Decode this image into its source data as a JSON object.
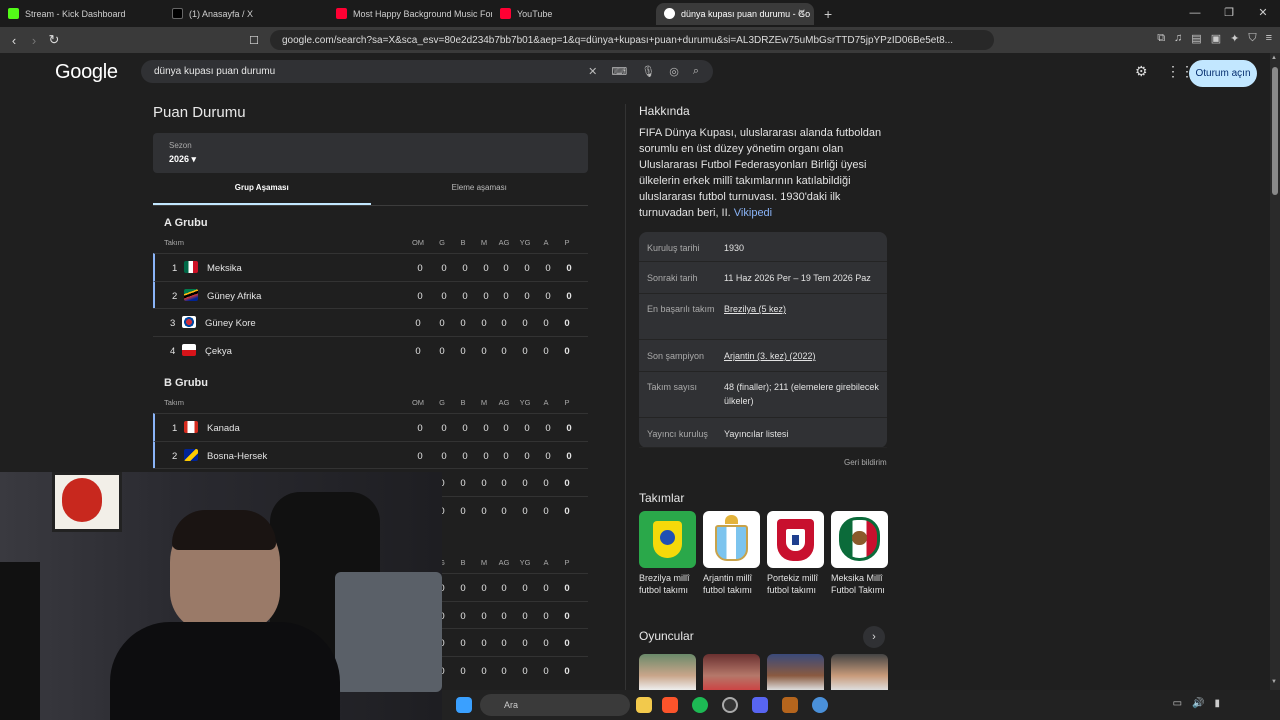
{
  "browser": {
    "tabs": [
      {
        "label": "Stream - Kick Dashboard",
        "color": "#53fc18"
      },
      {
        "label": "(1) Anasayfa / X",
        "color": "#000000"
      },
      {
        "label": "Most Happy Background Music For V",
        "color": "#ff0033"
      },
      {
        "label": "YouTube",
        "color": "#ff0033"
      },
      {
        "label": "dünya kupası puan durumu - Go",
        "color": "#ffffff"
      }
    ],
    "url": "google.com/search?sa=X&sca_esv=80e2d234b7bb7b01&aep=1&q=dünya+kupası+puan+durumu&si=AL3DRZEw75uMbGsrTTD75jpYPzID06Be5et8..."
  },
  "google": {
    "logo": "Google",
    "query": "dünya kupası puan durumu",
    "signin": "Oturum açın"
  },
  "standings": {
    "title": "Puan Durumu",
    "season_label": "Sezon",
    "season_value": "2026",
    "tab_group": "Grup Aşaması",
    "tab_knockout": "Eleme aşaması",
    "columns": {
      "team": "Takım",
      "om": "OM",
      "g": "G",
      "b": "B",
      "m": "M",
      "ag": "AG",
      "yg": "YG",
      "a": "A",
      "p": "P"
    },
    "groupA": {
      "name": "A Grubu",
      "rows": [
        {
          "pos": "1",
          "team": "Meksika",
          "v": [
            "0",
            "0",
            "0",
            "0",
            "0",
            "0",
            "0",
            "0"
          ]
        },
        {
          "pos": "2",
          "team": "Güney Afrika",
          "v": [
            "0",
            "0",
            "0",
            "0",
            "0",
            "0",
            "0",
            "0"
          ]
        },
        {
          "pos": "3",
          "team": "Güney Kore",
          "v": [
            "0",
            "0",
            "0",
            "0",
            "0",
            "0",
            "0",
            "0"
          ]
        },
        {
          "pos": "4",
          "team": "Çekya",
          "v": [
            "0",
            "0",
            "0",
            "0",
            "0",
            "0",
            "0",
            "0"
          ]
        }
      ]
    },
    "groupB": {
      "name": "B Grubu",
      "rows": [
        {
          "pos": "1",
          "team": "Kanada",
          "v": [
            "0",
            "0",
            "0",
            "0",
            "0",
            "0",
            "0",
            "0"
          ]
        },
        {
          "pos": "2",
          "team": "Bosna-Hersek",
          "v": [
            "0",
            "0",
            "0",
            "0",
            "0",
            "0",
            "0",
            "0"
          ]
        },
        {
          "pos": "",
          "team": "",
          "v": [
            "0",
            "0",
            "0",
            "0",
            "0",
            "0",
            "0",
            "0"
          ]
        },
        {
          "pos": "",
          "team": "",
          "v": [
            "0",
            "0",
            "0",
            "0",
            "0",
            "0",
            "0",
            "0"
          ]
        }
      ]
    },
    "groupC": {
      "rows": [
        {
          "pos": "",
          "team": "",
          "v": [
            "0",
            "0",
            "0",
            "0",
            "0",
            "0",
            "0",
            "0"
          ]
        },
        {
          "pos": "",
          "team": "",
          "v": [
            "0",
            "0",
            "0",
            "0",
            "0",
            "0",
            "0",
            "0"
          ]
        },
        {
          "pos": "",
          "team": "",
          "v": [
            "0",
            "0",
            "0",
            "0",
            "0",
            "0",
            "0",
            "0"
          ]
        },
        {
          "pos": "",
          "team": "",
          "v": [
            "0",
            "0",
            "0",
            "0",
            "0",
            "0",
            "0",
            "0"
          ]
        }
      ]
    }
  },
  "about": {
    "title": "Hakkında",
    "text": "FIFA Dünya Kupası, uluslararası alanda futboldan sorumlu en üst düzey yönetim organı olan Uluslararası Futbol Federasyonları Birliği üyesi ülkelerin erkek millî takımlarının katılabildiği uluslararası futbol turnuvası. 1930'daki ilk turnuvadan beri, II.",
    "link": "Vikipedi",
    "facts": [
      {
        "k": "Kuruluş tarihi",
        "v": "1930",
        "u": false
      },
      {
        "k": "Sonraki tarih",
        "v": "11 Haz 2026 Per – 19 Tem 2026 Paz",
        "u": false
      },
      {
        "k": "En başarılı takım",
        "v": "Brezilya (5 kez)",
        "u": true
      },
      {
        "k": "Son şampiyon",
        "v": "Arjantin (3. kez) (2022)",
        "u": true
      },
      {
        "k": "Takım sayısı",
        "v": "48 (finaller); 211 (elemelere girebilecek ülkeler)",
        "u": false
      },
      {
        "k": "Yayıncı kuruluş",
        "v": "Yayıncılar listesi",
        "u": false
      }
    ],
    "feedback": "Geri bildirim"
  },
  "teams": {
    "title": "Takımlar",
    "items": [
      {
        "name": "Brezilya millî futbol takımı"
      },
      {
        "name": "Arjantin millî futbol takımı"
      },
      {
        "name": "Portekiz millî futbol takımı"
      },
      {
        "name": "Meksika Millî Futbol Takımı"
      }
    ]
  },
  "players": {
    "title": "Oyuncular"
  },
  "taskbar": {
    "search": "Ara"
  }
}
